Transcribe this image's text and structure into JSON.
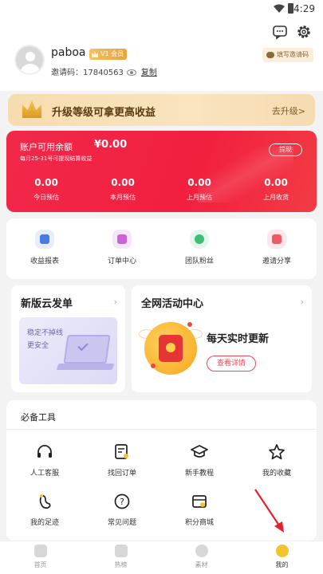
{
  "status_bar": {
    "time": "4:29"
  },
  "profile": {
    "username": "paboa",
    "vip_label": "V1 会员",
    "invite_label": "邀请码：",
    "invite_code": "17840563",
    "copy_label": "复制",
    "fill_code_label": "填写邀请码"
  },
  "upgrade": {
    "title": "升级等级可拿更高收益",
    "action": "去升级>"
  },
  "balance": {
    "label": "账户可用余额",
    "value": "¥0.00",
    "note": "每月25-31号可提现结算收益",
    "withdraw_label": "提现",
    "stats": [
      {
        "value": "0.00",
        "label": "今日预估"
      },
      {
        "value": "0.00",
        "label": "本月预估"
      },
      {
        "value": "0.00",
        "label": "上月预估"
      },
      {
        "value": "0.00",
        "label": "上月收货"
      }
    ]
  },
  "quick_links": [
    {
      "label": "收益报表",
      "icon": "report-icon",
      "color": "#4b7bdf"
    },
    {
      "label": "订单中心",
      "icon": "order-icon",
      "color": "#c765d6"
    },
    {
      "label": "团队粉丝",
      "icon": "team-icon",
      "color": "#3cbf77"
    },
    {
      "label": "邀请分享",
      "icon": "gift-icon",
      "color": "#ef5a6a"
    }
  ],
  "promos": {
    "cloud": {
      "title": "新版云发单",
      "line1": "稳定不掉线",
      "line2": "更安全"
    },
    "activity": {
      "title": "全网活动中心",
      "headline": "每天实时更新",
      "button": "查看详情"
    }
  },
  "tools": {
    "title": "必备工具",
    "items": [
      {
        "label": "人工客服",
        "icon": "headset-icon"
      },
      {
        "label": "找回订单",
        "icon": "find-order-icon"
      },
      {
        "label": "新手教程",
        "icon": "graduation-cap-icon"
      },
      {
        "label": "我的收藏",
        "icon": "star-icon"
      },
      {
        "label": "我的足迹",
        "icon": "footprint-icon"
      },
      {
        "label": "常见问题",
        "icon": "question-icon"
      },
      {
        "label": "积分商城",
        "icon": "points-mall-icon"
      }
    ]
  },
  "tabbar": [
    {
      "label": "首页",
      "icon": "home-icon",
      "active": false
    },
    {
      "label": "热榜",
      "icon": "fire-icon",
      "active": false
    },
    {
      "label": "素材",
      "icon": "material-icon",
      "active": false
    },
    {
      "label": "我的",
      "icon": "profile-icon",
      "active": true
    }
  ],
  "colors": {
    "accent_red": "#f2284a",
    "gold": "#f2c52f"
  }
}
